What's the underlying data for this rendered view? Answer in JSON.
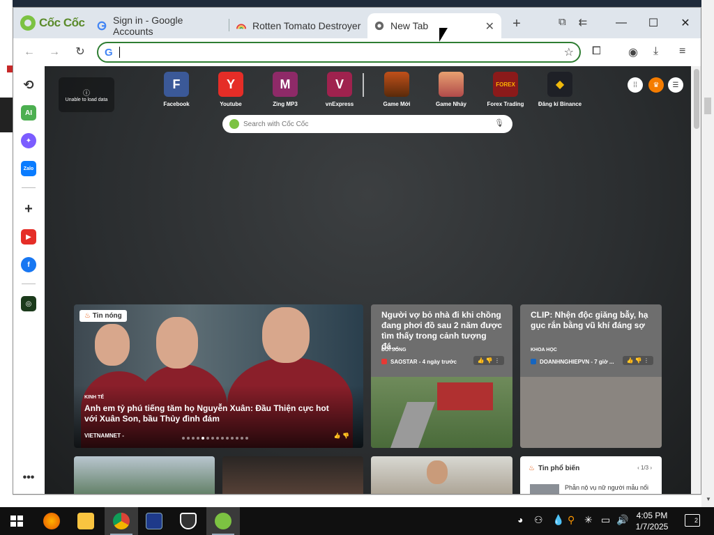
{
  "browser": {
    "brand": "Cốc Cốc",
    "tabs": [
      {
        "label": "Sign in - Google Accounts",
        "icon": "google-g-icon"
      },
      {
        "label": "Rotten Tomato Destroyer",
        "icon": "rainbow-icon"
      },
      {
        "label": "New Tab",
        "icon": "coccoc-icon",
        "active": true
      }
    ],
    "address": {
      "value": "",
      "placeholder": ""
    }
  },
  "weather": {
    "text": "Unable to load data"
  },
  "speed_dial": [
    {
      "label": "Facebook",
      "letter": "F",
      "color": "#3b5998"
    },
    {
      "label": "Youtube",
      "letter": "Y",
      "color": "#e52d27"
    },
    {
      "label": "Zing MP3",
      "letter": "M",
      "color": "#8e2a68"
    },
    {
      "label": "vnExpress",
      "letter": "V",
      "color": "#9f224e"
    },
    {
      "label": "Game Mới",
      "letter": "",
      "color": "#7a3b15"
    },
    {
      "label": "Game Nhảy",
      "letter": "",
      "color": "#c97b4b"
    },
    {
      "label": "Forex Trading",
      "letter": "FOREX",
      "color": "#8b1a1a"
    },
    {
      "label": "Đăng kí Binance",
      "letter": "",
      "color": "#1e2026"
    }
  ],
  "search": {
    "placeholder": "Search with Cốc Cốc"
  },
  "news": {
    "hero": {
      "badge": "Tin nóng",
      "category": "KINH TẾ",
      "title": "Anh em tỷ phú tiếng tăm họ Nguyễn Xuân: Đầu Thiện cực hot với Xuân Son, bầu Thủy đình đám",
      "source": "VIETNAMNET -"
    },
    "card1": {
      "title": "Người vợ bỏ nhà đi khi chồng đang phơi đồ sau 2 năm được tìm thấy trong cảnh tượng đá...",
      "category": "ĐỜI SỐNG",
      "source": "SAOSTAR - 4 ngày trước"
    },
    "card2": {
      "title": "CLIP: Nhện độc giăng bẫy, hạ gục rắn bằng vũ khí đáng sợ",
      "category": "KHOA HỌC",
      "source": "DOANHNGHIEPVN - 7 giờ ..."
    },
    "popular": {
      "title": "Tin phổ biến",
      "pager": "1/3",
      "item": "Phẫn nộ vụ nữ người mẫu nổi"
    }
  },
  "taskbar": {
    "time": "4:05 PM",
    "date": "1/7/2025",
    "notifications": "2"
  }
}
